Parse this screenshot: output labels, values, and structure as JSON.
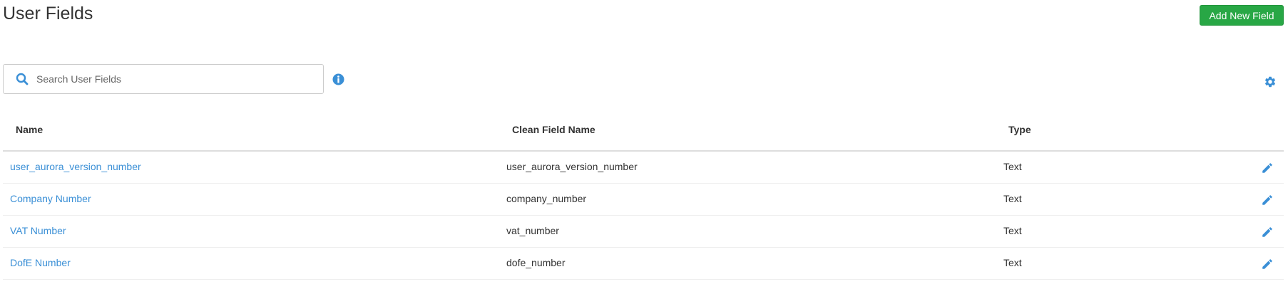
{
  "header": {
    "title": "User Fields",
    "add_button_label": "Add New Field"
  },
  "search": {
    "placeholder": "Search User Fields",
    "value": ""
  },
  "table": {
    "columns": [
      "Name",
      "Clean Field Name",
      "Type"
    ],
    "rows": [
      {
        "name": "user_aurora_version_number",
        "clean_name": "user_aurora_version_number",
        "type": "Text"
      },
      {
        "name": "Company Number",
        "clean_name": "company_number",
        "type": "Text"
      },
      {
        "name": "VAT Number",
        "clean_name": "vat_number",
        "type": "Text"
      },
      {
        "name": "DofE Number",
        "clean_name": "dofe_number",
        "type": "Text"
      }
    ]
  },
  "icons": {
    "search": "search-icon",
    "info": "info-icon",
    "settings": "gear-icon",
    "edit": "pencil-icon"
  },
  "colors": {
    "primary_button": "#28a745",
    "link": "#3a8fd6",
    "icon_blue": "#3a8fd6"
  }
}
